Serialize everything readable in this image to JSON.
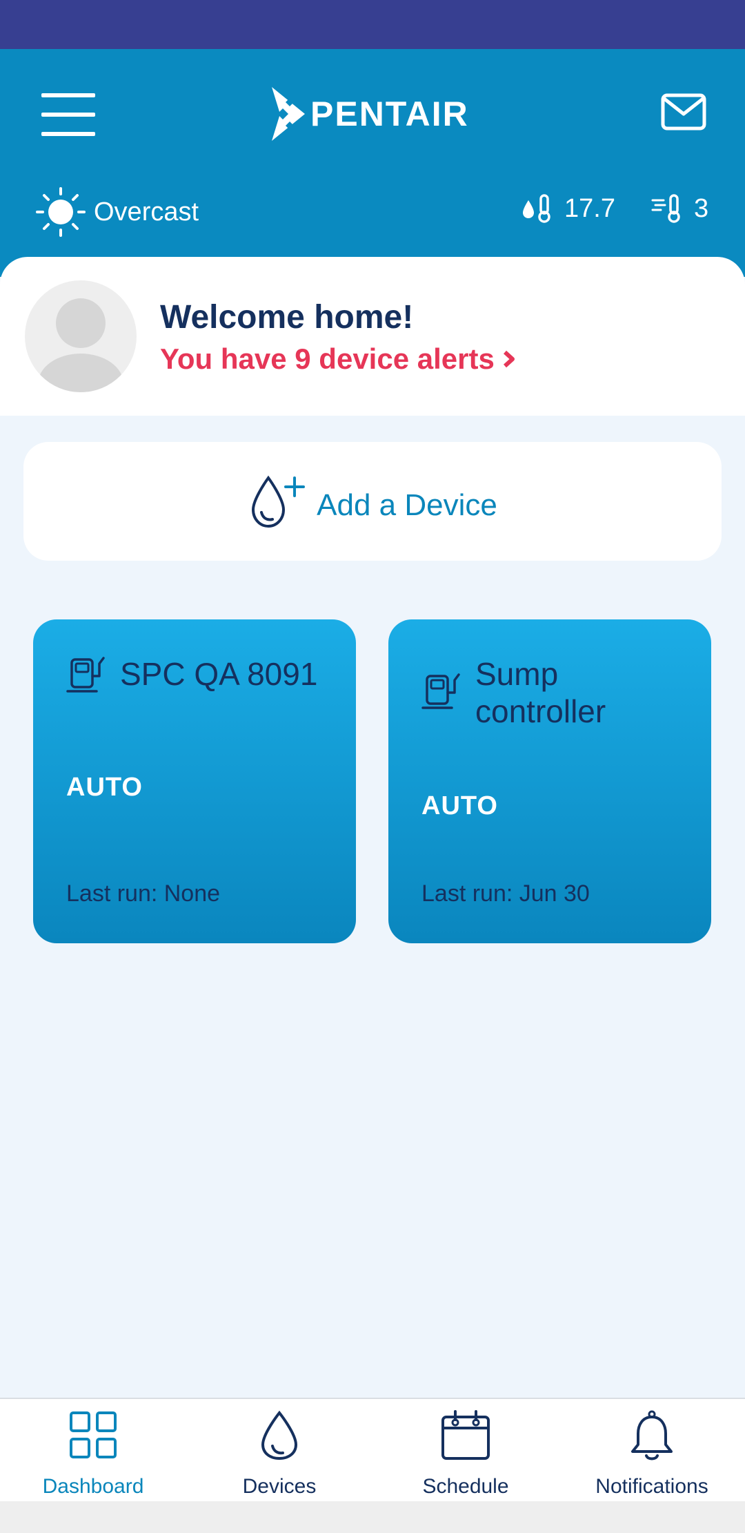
{
  "colors": {
    "status_bar": "#373f91",
    "header": "#0a8ac0",
    "accent": "#0a86bb",
    "alert": "#e63657",
    "navy": "#15305e",
    "card_top": "#1bade6",
    "card_bottom": "#0a86be",
    "background": "#eef5fc"
  },
  "header": {
    "menu_icon": "hamburger-menu-icon",
    "logo_text": "PENTAIR",
    "mail_icon": "envelope-icon",
    "weather": {
      "icon": "sun-icon",
      "label": "Overcast"
    },
    "temperature": {
      "icon": "water-thermometer-icon",
      "value": "17.7"
    },
    "wind": {
      "icon": "wind-thermometer-icon",
      "value": "3"
    }
  },
  "welcome": {
    "title": "Welcome home!",
    "alerts_text": "You have 9 device alerts"
  },
  "add_device": {
    "icon": "droplet-plus-icon",
    "label": "Add a Device"
  },
  "devices": [
    {
      "icon": "sump-pump-icon",
      "name": "SPC QA 8091",
      "mode": "AUTO",
      "last_run": "Last run: None"
    },
    {
      "icon": "sump-pump-icon",
      "name": "Sump controller",
      "mode": "AUTO",
      "last_run": "Last run: Jun 30"
    }
  ],
  "nav": [
    {
      "icon": "grid-icon",
      "label": "Dashboard",
      "active": true
    },
    {
      "icon": "droplet-icon",
      "label": "Devices",
      "active": false
    },
    {
      "icon": "calendar-icon",
      "label": "Schedule",
      "active": false
    },
    {
      "icon": "bell-icon",
      "label": "Notifications",
      "active": false
    }
  ]
}
